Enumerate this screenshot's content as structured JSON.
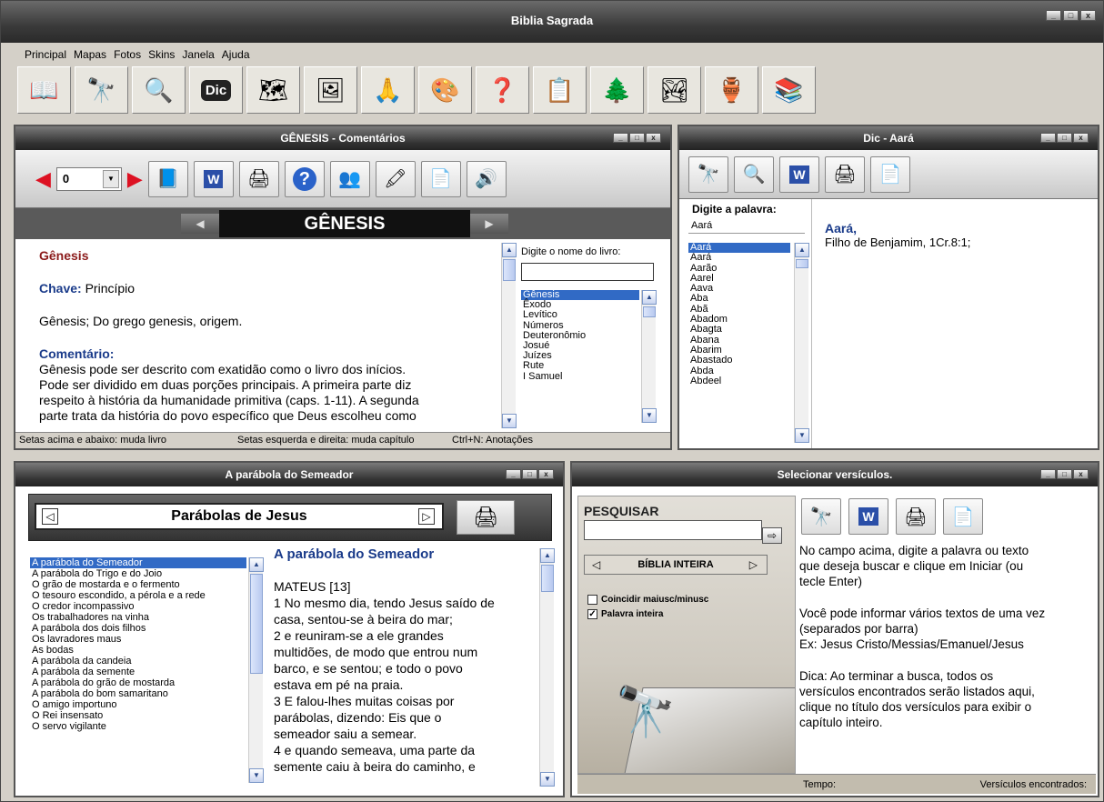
{
  "app": {
    "title": "Biblia Sagrada"
  },
  "menu": [
    "Principal",
    "Mapas",
    "Fotos",
    "Skins",
    "Janela",
    "Ajuda"
  ],
  "toolbar": {
    "icons": [
      "book-icon",
      "binoculars-icon",
      "search-icon",
      "dictionary-icon",
      "map-icon",
      "photos-icon",
      "prayer-icon",
      "skins-icon",
      "quiz-icon",
      "checklist-icon",
      "tree-icon",
      "landscape-icon",
      "jar-icon",
      "books-icon"
    ],
    "labels": [
      "Dic"
    ]
  },
  "genesis_panel": {
    "title": "GÊNESIS - Comentários",
    "chapter_value": "0",
    "book_name": "GÊNESIS",
    "heading": "Gênesis",
    "chave_label": "Chave:",
    "chave_value": " Princípio",
    "line1": "Gênesis; Do grego genesis, origem.",
    "comentario_label": "Comentário:",
    "comentario_lines": [
      "Gênesis pode ser descrito com exatidão como o livro dos inícios.",
      "Pode ser dividido em duas porções principais. A primeira parte diz",
      "respeito à história da humanidade primitiva (caps. 1-11). A segunda",
      "parte trata da história do povo específico que Deus escolheu como"
    ],
    "book_search_label": "Digite o nome do livro:",
    "book_search_value": "",
    "books": [
      "Gênesis",
      "Êxodo",
      "Levítico",
      "Números",
      "Deuteronômio",
      "Josué",
      "Juízes",
      "Rute",
      "I Samuel"
    ],
    "status_1": "Setas acima e abaixo: muda livro",
    "status_2": "Setas esquerda e direita: muda capítulo",
    "status_3": "Ctrl+N: Anotações"
  },
  "dic_panel": {
    "title": "Dic - Aará",
    "search_label": "Digite a palavra:",
    "search_value": "Aará",
    "words": [
      "Aará",
      "Aará",
      "Aarão",
      "Aarel",
      "Aava",
      "Aba",
      "Abã",
      "Abadom",
      "Abagta",
      "Abana",
      "Abarim",
      "Abastado",
      "Abda",
      "Abdeel"
    ],
    "entry_title": "Aará,",
    "entry_text": "Filho de Benjamim, 1Cr.8:1;"
  },
  "parable_panel": {
    "title": "A parábola do Semeador",
    "category": "Parábolas de Jesus",
    "parables": [
      "A parábola do Semeador",
      "A parábola do Trigo e do Joio",
      "O grão de mostarda e o fermento",
      "O tesouro escondido, a pérola e a rede",
      "O credor incompassivo",
      "Os trabalhadores na vinha",
      "A parábola dos dois filhos",
      "Os lavradores maus",
      "As bodas",
      "A parábola da candeia",
      "A parábola da semente",
      "A parábola do grão de mostarda",
      "A parábola do bom samaritano",
      "O amigo importuno",
      "O Rei insensato",
      "O servo vigilante"
    ],
    "text_title": "A parábola do Semeador",
    "text_lines": [
      "MATEUS [13]",
      "1 No mesmo dia, tendo Jesus saído de",
      "casa, sentou-se à beira do mar;",
      "2 e reuniram-se a ele grandes",
      "multidões, de modo que entrou num",
      "barco, e se sentou; e todo o povo",
      "estava em pé na praia.",
      "3 E falou-lhes muitas coisas por",
      "parábolas, dizendo: Eis que o",
      "semeador saiu a semear.",
      "4 e quando semeava, uma parte da",
      "semente caiu à beira do caminho, e"
    ]
  },
  "verses_panel": {
    "title": "Selecionar versículos.",
    "search_heading": "PESQUISAR",
    "search_value": "",
    "scope": "BÍBLIA INTEIRA",
    "option_case": "Coincidir maiusc/minusc",
    "option_case_checked": false,
    "option_whole": "Palavra inteira",
    "option_whole_checked": true,
    "help_1": [
      "No campo acima, digite a palavra ou texto",
      "que deseja buscar e clique em Iniciar (ou",
      "tecle Enter)"
    ],
    "help_2": [
      "Você pode informar vários textos de uma vez",
      "(separados por barra)",
      "Ex: Jesus Cristo/Messias/Emanuel/Jesus"
    ],
    "help_3": [
      "Dica: Ao terminar a busca, todos os",
      "versículos encontrados serão listados aqui,",
      "clique no título dos versículos para exibir o",
      "capítulo inteiro."
    ],
    "status_time": "Tempo:",
    "status_found": "Versículos encontrados:"
  }
}
